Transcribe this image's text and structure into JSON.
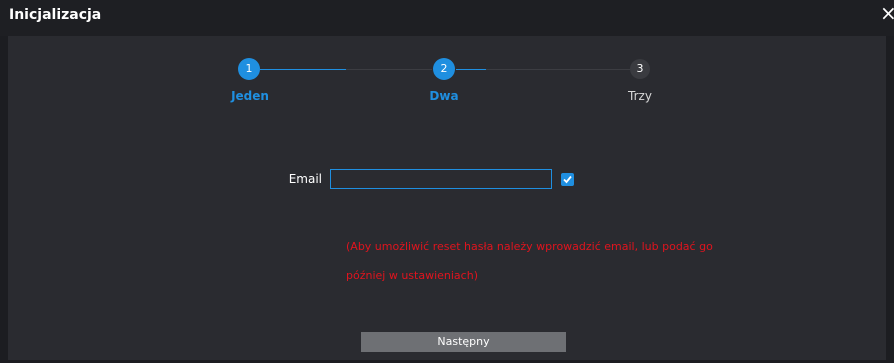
{
  "window": {
    "title": "Inicjalizacja",
    "close_glyph": "×"
  },
  "stepper": {
    "current_step": 2,
    "steps": [
      {
        "number": "1",
        "label": "Jeden",
        "state": "done"
      },
      {
        "number": "2",
        "label": "Dwa",
        "state": "active"
      },
      {
        "number": "3",
        "label": "Trzy",
        "state": "pending"
      }
    ]
  },
  "form": {
    "email_label": "Email",
    "email_value": "",
    "email_placeholder": "",
    "checkbox_checked": true,
    "hint": "(Aby umożliwić reset hasła należy wprowadzić email, lub podać go później w ustawieniach)"
  },
  "actions": {
    "next_label": "Następny"
  },
  "colors": {
    "accent": "#1f8fe0",
    "hint": "#e0141e",
    "background": "#2a2b30",
    "button": "#6e7074"
  },
  "icons": {
    "close": "close-icon",
    "check": "check-icon"
  }
}
